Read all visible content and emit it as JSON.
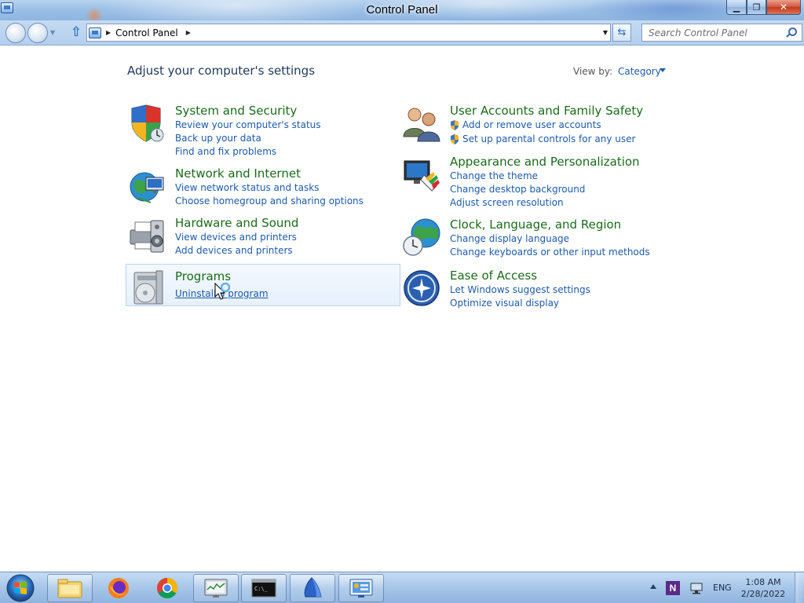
{
  "window": {
    "title": "Control Panel",
    "min_glyph": "▁",
    "max_glyph": "❐",
    "close_glyph": "✕"
  },
  "nav": {
    "breadcrumb": "Control Panel",
    "search_placeholder": "Search Control Panel",
    "refresh_glyph": "⇆"
  },
  "main": {
    "title": "Adjust your computer's settings",
    "view_by_label": "View by:",
    "view_by_value": "Category"
  },
  "categories": [
    {
      "title": "System and Security",
      "icon": "shield-icon",
      "links": [
        "Review your computer's status",
        "Back up your data",
        "Find and fix problems"
      ]
    },
    {
      "title": "Network and Internet",
      "icon": "network-globe-icon",
      "links": [
        "View network status and tasks",
        "Choose homegroup and sharing options"
      ]
    },
    {
      "title": "Hardware and Sound",
      "icon": "printer-speaker-icon",
      "links": [
        "View devices and printers",
        "Add devices and printers"
      ]
    },
    {
      "title": "Programs",
      "icon": "programs-cd-icon",
      "links": [
        "Uninstall a program"
      ]
    },
    {
      "title": "User Accounts and Family Safety",
      "icon": "users-icon",
      "links": [
        "Add or remove user accounts",
        "Set up parental controls for any user"
      ]
    },
    {
      "title": "Appearance and Personalization",
      "icon": "monitor-paint-icon",
      "links": [
        "Change the theme",
        "Change desktop background",
        "Adjust screen resolution"
      ]
    },
    {
      "title": "Clock, Language, and Region",
      "icon": "clock-globe-icon",
      "links": [
        "Change display language",
        "Change keyboards or other input methods"
      ]
    },
    {
      "title": "Ease of Access",
      "icon": "ease-of-access-icon",
      "links": [
        "Let Windows suggest settings",
        "Optimize visual display"
      ]
    }
  ],
  "taskbar": {
    "items": [
      "explorer-icon",
      "firefox-icon",
      "chrome-icon",
      "task-manager-icon",
      "command-prompt-icon",
      "sail-app-icon",
      "control-panel-icon"
    ],
    "tray": {
      "lang": "ENG",
      "n_icon": "N",
      "time": "1:08 AM",
      "date": "2/28/2022"
    }
  },
  "colors": {
    "category_title": "#1a6a1a",
    "link": "#1e5aa8",
    "heading": "#1e395b"
  }
}
